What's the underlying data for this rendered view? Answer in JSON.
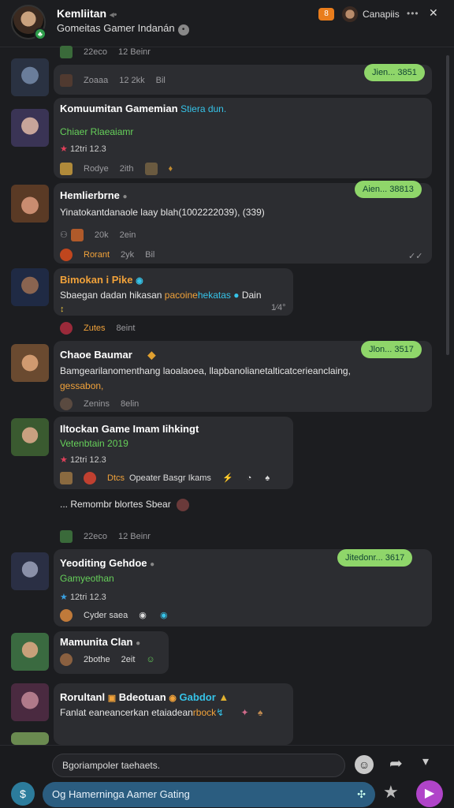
{
  "header": {
    "title": "Kemliitan",
    "subtitle": "Gomeitas Gamer Indanán",
    "badge_count": "8",
    "user_name": "Canapiis",
    "more": "•••",
    "close": "✕"
  },
  "messages": [
    {
      "meta": [
        "22eco",
        "12 Beinr"
      ]
    },
    {
      "meta": [
        "Zoaaa",
        "12 2kk",
        "Bil"
      ],
      "pill": "Jien... 3851"
    },
    {
      "name": "Komuumitan Gamemian",
      "name_tag": "Stiera dun.",
      "line1": "Chiaer Rlaeaiamr",
      "line2": "12tri 12.3",
      "meta": [
        "Rodye",
        "2ith"
      ]
    },
    {
      "name": "Hemlierbrne",
      "text": "Yinatokantdanaole laay blah(1002222039), (339)",
      "meta": [
        "20k",
        "2ein"
      ],
      "meta2": [
        "Rorant",
        "2yk",
        "Bil"
      ],
      "pill": "Aien... 38813",
      "edited": "✓✓"
    },
    {
      "name": "Bimokan i Pike",
      "text_a": "Sbaegan dadan hikasan",
      "text_b": "pacoine",
      "text_c": "hekatas",
      "text_d": "Dain",
      "meta": [
        "Zutes",
        "8eint"
      ],
      "time": "1⁄4°"
    },
    {
      "name": "Chaoe Baumar",
      "text": "Bamgearilanomenthang laoalaoea, llapbanolianetalticatcerieanclaing,",
      "text2": "gessabon,",
      "meta": [
        "Zenins",
        "8elin"
      ],
      "pill": "Jlon... 3517"
    },
    {
      "name": "Iltockan Game Imam Iihkingt",
      "line1": "Vetenbtain 2019",
      "line2": "12tri 12.3",
      "meta_a": "Dtcs",
      "meta_b": "Opeater Basgr Ikams"
    },
    {
      "system": "... Remombr blortes Sbear"
    },
    {
      "meta": [
        "22eco",
        "12 Beinr"
      ]
    },
    {
      "name": "Yeoditing Gehdoe",
      "line1": "Gamyeothan",
      "line2": "12tri 12.3",
      "meta": [
        "Cyder saea"
      ],
      "pill": "Jitedonr... 3617"
    },
    {
      "name": "Mamunita Clan",
      "meta": [
        "2bothe",
        "2eit"
      ]
    },
    {
      "name_a": "Rorultanl",
      "name_b": "Bdeotuan",
      "name_c": "Gabdor",
      "text": "Fanlat eaneancerkan etaiadean",
      "text_b": "rbock"
    }
  ],
  "composer": {
    "reply_placeholder": "Bgoriampoler taehaets.",
    "input_value": "Og Hamerninga Aamer Gating"
  },
  "colors": {
    "accent_green": "#8fd66a",
    "accent_purple": "#b044c9",
    "accent_blue": "#2b5d80"
  }
}
